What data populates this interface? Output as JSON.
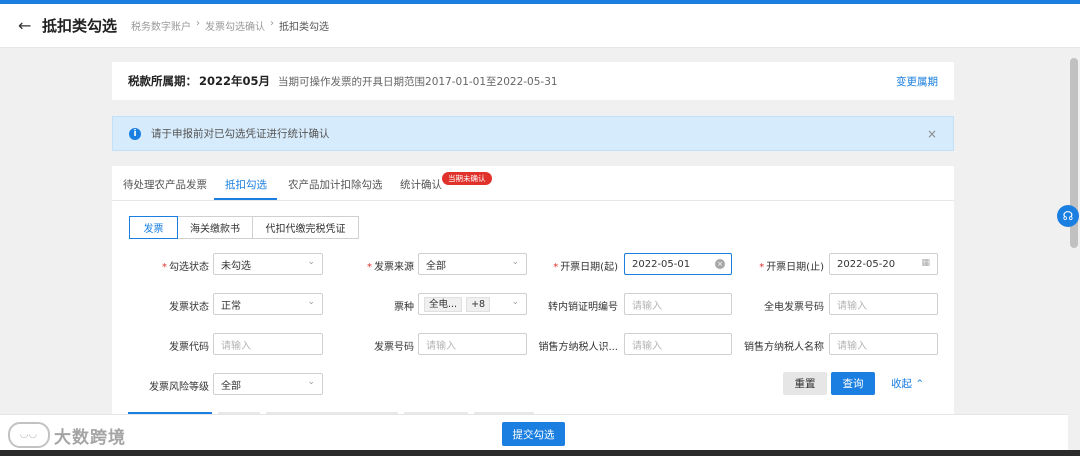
{
  "header": {
    "title": "抵扣类勾选",
    "breadcrumb": [
      "税务数字账户",
      "发票勾选确认",
      "抵扣类勾选"
    ]
  },
  "period": {
    "label": "税款所属期：",
    "value": "2022年05月",
    "range": "当期可操作发票的开具日期范围2017-01-01至2022-05-31",
    "change_link": "变更属期"
  },
  "alert": {
    "message": "请于申报前对已勾选凭证进行统计确认"
  },
  "tabs": {
    "items": [
      "待处理农产品发票",
      "抵扣勾选",
      "农产品加计扣除勾选",
      "统计确认"
    ],
    "active": "抵扣勾选",
    "badge": "当期未确认"
  },
  "doc_types": {
    "items": [
      "发票",
      "海关缴款书",
      "代扣代缴完税凭证"
    ],
    "active": "发票"
  },
  "filters": {
    "check_status": {
      "label": "勾选状态",
      "value": "未勾选"
    },
    "invoice_source": {
      "label": "发票来源",
      "value": "全部"
    },
    "issue_date_start": {
      "label": "开票日期(起)",
      "value": "2022-05-01"
    },
    "issue_date_end": {
      "label": "开票日期(止)",
      "value": "2022-05-20"
    },
    "invoice_status": {
      "label": "发票状态",
      "value": "正常"
    },
    "ticket_type": {
      "label": "票种",
      "value": "全电...",
      "extra": "+8"
    },
    "transfer_no": {
      "label": "转内销证明编号",
      "placeholder": "请输入"
    },
    "full_elec_no": {
      "label": "全电发票号码",
      "placeholder": "请输入"
    },
    "invoice_code": {
      "label": "发票代码",
      "placeholder": "请输入"
    },
    "invoice_no": {
      "label": "发票号码",
      "placeholder": "请输入"
    },
    "seller_tax_id": {
      "label": "销售方纳税人识...",
      "placeholder": "请输入"
    },
    "seller_name": {
      "label": "销售方纳税人名称",
      "placeholder": "请输入"
    },
    "risk_level": {
      "label": "发票风险等级",
      "value": "全部"
    }
  },
  "actions": {
    "reset": "重置",
    "query": "查询",
    "collapse": "收起"
  },
  "footer": {
    "submit": "提交勾选"
  },
  "watermark": "大数跨境",
  "colors": {
    "primary": "#1a7fe0",
    "danger": "#e0322b",
    "alert_bg": "#d6ebfb"
  }
}
